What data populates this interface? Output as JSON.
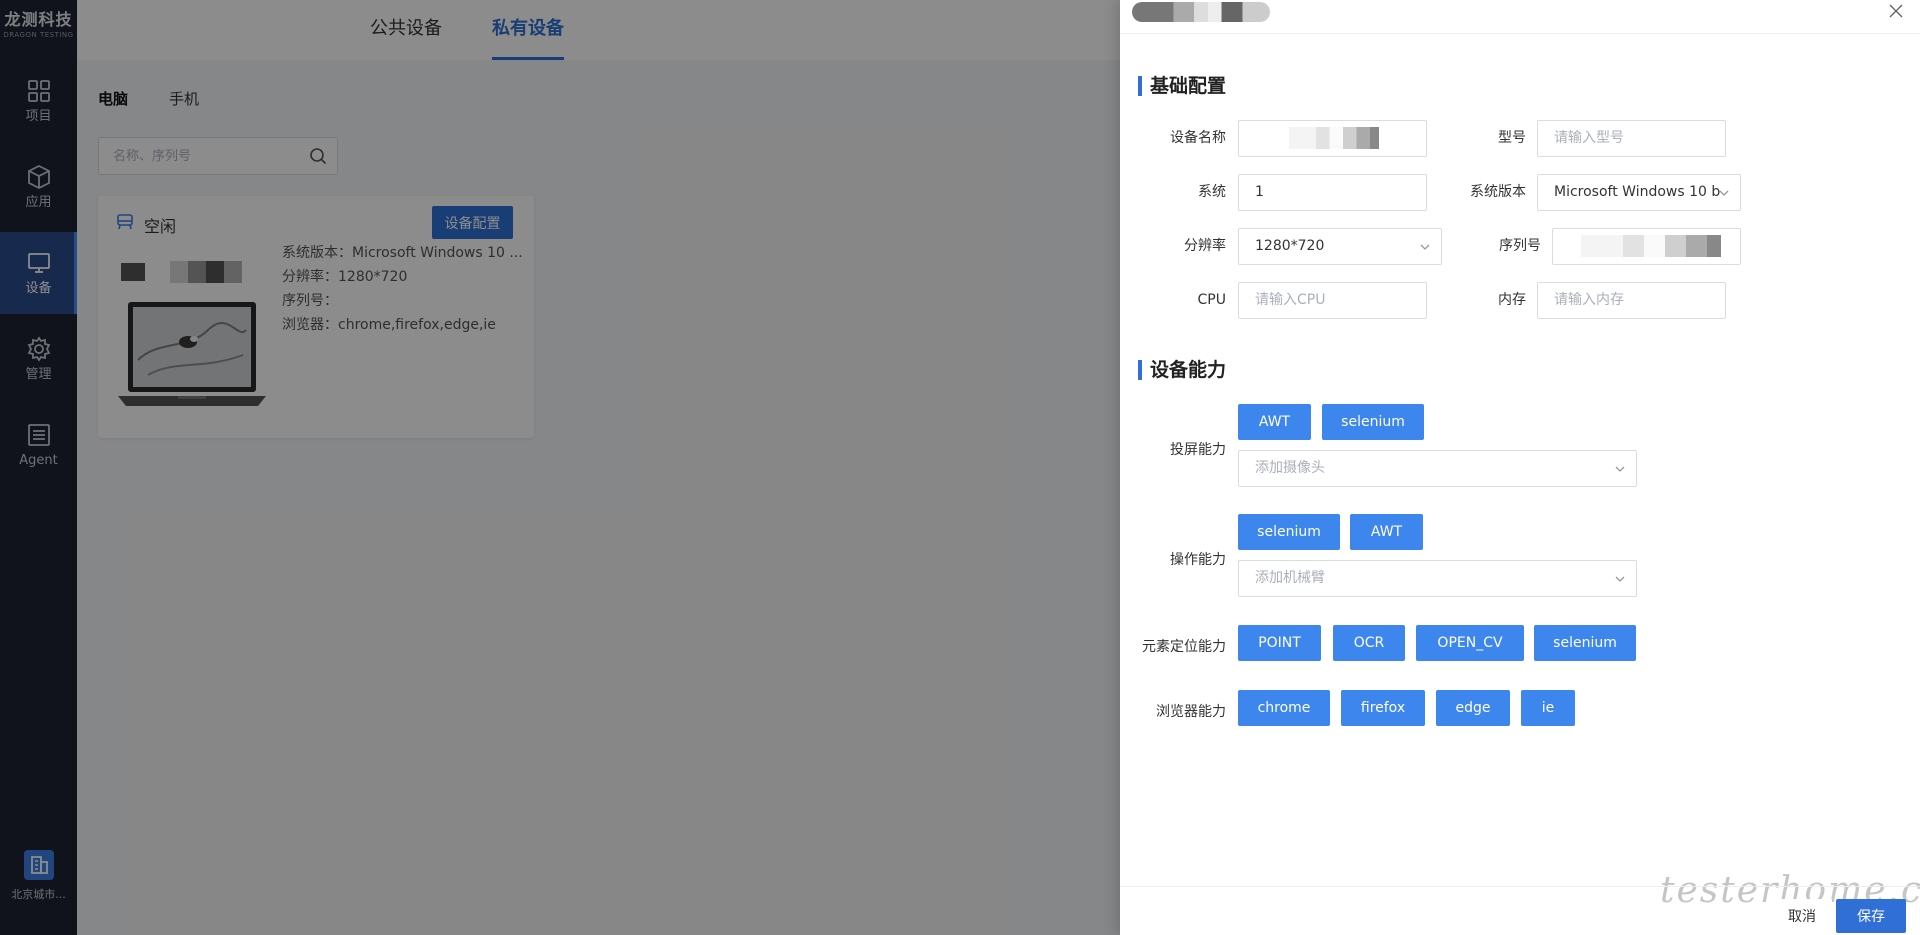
{
  "sidebar": {
    "logo": {
      "main": "龙测科技",
      "sub": "DRAGON TESTING"
    },
    "items": [
      {
        "label": "项目",
        "icon": "grid-icon"
      },
      {
        "label": "应用",
        "icon": "cube-icon"
      },
      {
        "label": "设备",
        "icon": "monitor-icon",
        "active": true
      },
      {
        "label": "管理",
        "icon": "gear-icon"
      },
      {
        "label": "Agent",
        "icon": "list-icon"
      }
    ],
    "org": {
      "label": "北京城市..."
    }
  },
  "main": {
    "top_tabs": [
      {
        "label": "公共设备"
      },
      {
        "label": "私有设备",
        "active": true
      }
    ],
    "sub_tabs": [
      {
        "label": "电脑",
        "active": true
      },
      {
        "label": "手机"
      }
    ],
    "search": {
      "placeholder": "名称、序列号"
    },
    "device_card": {
      "status": "空闲",
      "config_button": "设备配置",
      "info": [
        "系统版本：Microsoft Windows 10 ...",
        "分辨率：1280*720",
        "序列号：",
        "浏览器：chrome,firefox,edge,ie"
      ]
    }
  },
  "drawer": {
    "sections": {
      "basic": "基础配置",
      "capability": "设备能力"
    },
    "fields": {
      "device_name": {
        "label": "设备名称",
        "value": ""
      },
      "model": {
        "label": "型号",
        "placeholder": "请输入型号"
      },
      "system": {
        "label": "系统",
        "value": "1"
      },
      "system_version": {
        "label": "系统版本",
        "value": "Microsoft Windows 10 b"
      },
      "resolution": {
        "label": "分辨率",
        "value": "1280*720"
      },
      "serial": {
        "label": "序列号",
        "value": ""
      },
      "cpu": {
        "label": "CPU",
        "placeholder": "请输入CPU"
      },
      "memory": {
        "label": "内存",
        "placeholder": "请输入内存"
      }
    },
    "capabilities": {
      "screen": {
        "label": "投屏能力",
        "tags": [
          "AWT",
          "selenium"
        ],
        "select_placeholder": "添加摄像头"
      },
      "operation": {
        "label": "操作能力",
        "tags": [
          "selenium",
          "AWT"
        ],
        "select_placeholder": "添加机械臂"
      },
      "locate": {
        "label": "元素定位能力",
        "tags": [
          "POINT",
          "OCR",
          "OPEN_CV",
          "selenium"
        ]
      },
      "browser": {
        "label": "浏览器能力",
        "tags": [
          "chrome",
          "firefox",
          "edge",
          "ie"
        ]
      }
    },
    "footer": {
      "cancel": "取消",
      "save": "保存"
    },
    "watermark": "testerhome.com"
  },
  "colors": {
    "primary": "#2f6fd6",
    "tag": "#3c86ee",
    "sidebar_bg": "#1f2333",
    "sidebar_active": "#2a4d8f"
  }
}
